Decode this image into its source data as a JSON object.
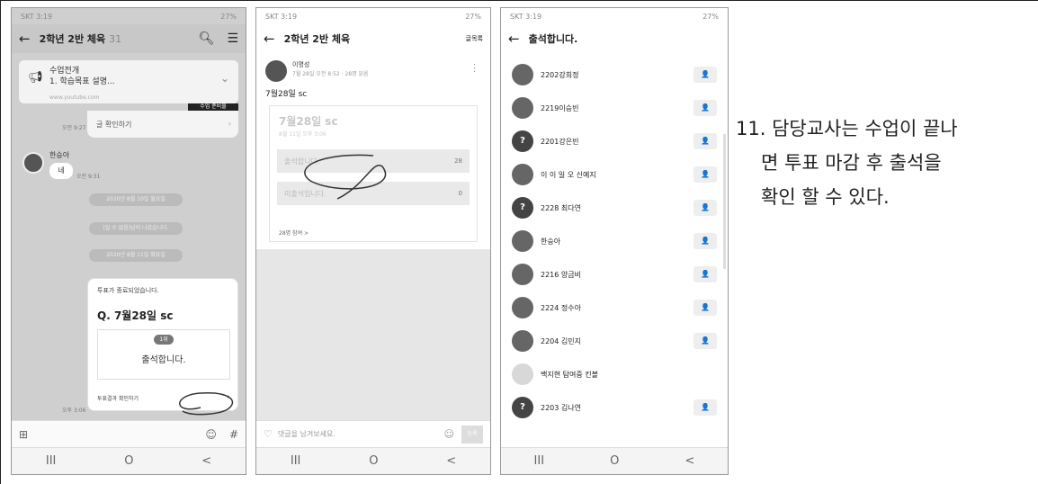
{
  "phone1": {
    "status_left": "SKT 3:19",
    "status_right": "27%",
    "title": "2학년 2반 체육",
    "member_count": "31",
    "notice_line1": "수업전개",
    "notice_line2": "1. 학습목표 설명...",
    "notice_thumb": "www.youtube.com",
    "black_badge": "수업 준비물",
    "view_post": "글 확인하기",
    "time1": "오전 9:27",
    "sender": "한승아",
    "reply": "네",
    "time2": "오전 9:31",
    "date_pill1": "2020년 8월 10일 월요일",
    "date_pill2": "(일 수 없음)님이 나갔습니다.",
    "date_pill3": "2020년 8월 11일 화요일",
    "vote_ended": "투표가 종료되었습니다.",
    "vote_question": "Q. 7월28일 sc",
    "vote_rank": "1위",
    "vote_option": "출석합니다.",
    "vote_result": "투표결과 확인하기",
    "time3": "오후 3:06",
    "nav_recent": "III",
    "nav_home": "O",
    "nav_back": "<"
  },
  "phone2": {
    "status_left": "SKT 3:19",
    "status_right": "27%",
    "title": "2학년 2반 체육",
    "action": "글목록",
    "author": "이명성",
    "author_date": "7월 28일 오전 8:52 · 28명 읽음",
    "post_title": "7월28일 sc",
    "poll_title": "7월28일 sc",
    "poll_date": "8월 11일 오후 3:06",
    "option1": "출석합니다.",
    "option1_count": "28",
    "option2": "미출석입니다.",
    "option2_count": "0",
    "participants": "28명 참여 >",
    "comment_placeholder": "댓글을 남겨보세요.",
    "send": "등록",
    "nav_recent": "III",
    "nav_home": "O",
    "nav_back": "<"
  },
  "phone3": {
    "status_left": "SKT 3:19",
    "status_right": "27%",
    "title": "출석합니다.",
    "students": [
      {
        "name": "2202강희정",
        "av": "",
        "chip": "👤"
      },
      {
        "name": "2219이승빈",
        "av": "",
        "chip": "👤"
      },
      {
        "name": "2201강은빈",
        "av": "?",
        "chip": "👤"
      },
      {
        "name": "이 이 일 오 신예지",
        "av": "",
        "chip": "👤"
      },
      {
        "name": "2228 최다연",
        "av": "?",
        "chip": "👤"
      },
      {
        "name": "한승아",
        "av": "",
        "chip": "👤"
      },
      {
        "name": "2216 양금비",
        "av": "",
        "chip": "👤"
      },
      {
        "name": "2224 정수아",
        "av": "",
        "chip": "👤"
      },
      {
        "name": "2204 김민지",
        "av": "",
        "chip": "👤"
      },
      {
        "name": "백지현 탐여중 킨볼",
        "av": "",
        "chip": ""
      },
      {
        "name": "2203 김나연",
        "av": "?",
        "chip": "👤"
      }
    ],
    "nav_recent": "III",
    "nav_home": "O",
    "nav_back": "<"
  },
  "caption": {
    "line1": "11. 담당교사는 수업이 끝나",
    "line2": "면 투표 마감 후 출석을",
    "line3": "확인 할 수 있다."
  }
}
